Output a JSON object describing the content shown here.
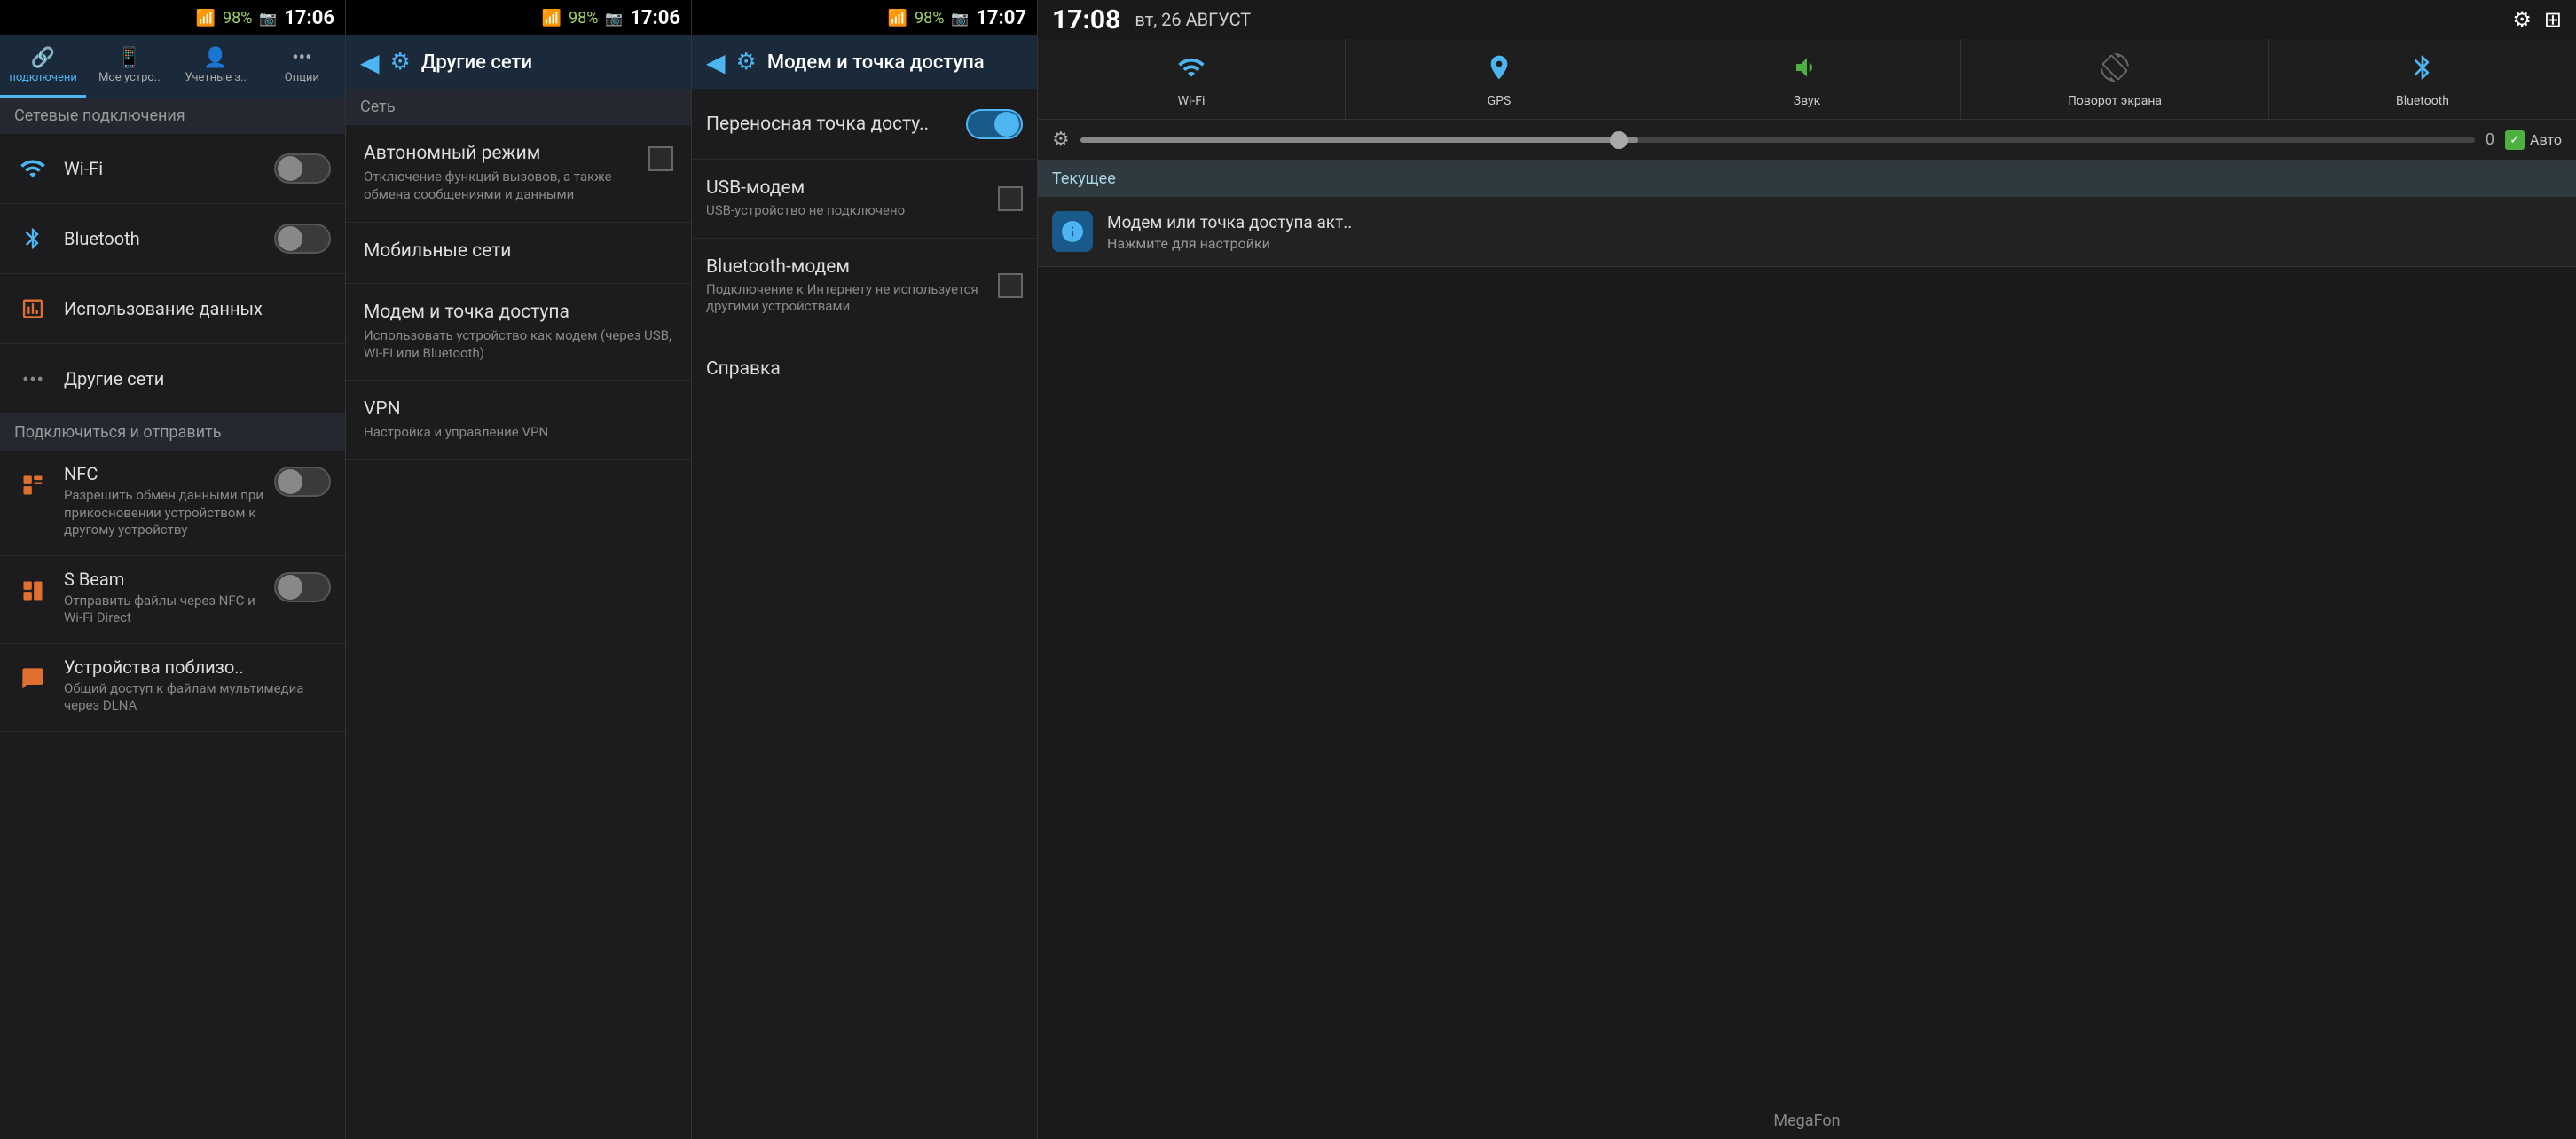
{
  "panel1": {
    "statusBar": {
      "signal": "▲▲",
      "battery": "98%",
      "time": "17:06",
      "cameraIcon": "▣"
    },
    "tabs": [
      {
        "label": "подключени",
        "icon": "🔗",
        "active": true
      },
      {
        "label": "Мое устро..",
        "icon": "📱",
        "active": false
      },
      {
        "label": "Учетные з..",
        "icon": "👤",
        "active": false
      },
      {
        "label": "Опции",
        "icon": "⋯",
        "active": false
      }
    ],
    "sectionHeader": "Сетевые подключения",
    "rows": [
      {
        "title": "Wi-Fi",
        "icon": "wifi",
        "toggle": true,
        "toggleOn": false
      },
      {
        "title": "Bluetooth",
        "icon": "bt",
        "toggle": true,
        "toggleOn": false
      }
    ],
    "section2Header": "",
    "rows2": [
      {
        "title": "Использование данных",
        "icon": "data"
      },
      {
        "title": "Другие сети",
        "icon": "net"
      }
    ],
    "section3Header": "Подключиться и отправить",
    "rows3": [
      {
        "title": "NFC",
        "subtitle": "Разрешить обмен данными при прикосновении устройством к другому устройству",
        "icon": "nfc",
        "toggle": true,
        "toggleOn": false
      },
      {
        "title": "S Beam",
        "subtitle": "Отправить файлы через NFC и Wi-Fi Direct",
        "icon": "sbeam",
        "toggle": true,
        "toggleOn": false
      },
      {
        "title": "Устройства поблизо..",
        "subtitle": "Общий доступ к файлам мультимедиа через DLNA",
        "icon": "nearby",
        "toggle": false
      }
    ]
  },
  "panel2": {
    "statusBar": {
      "battery": "98%",
      "time": "17:06",
      "cameraIcon": "▣"
    },
    "header": {
      "title": "Другие сети",
      "backIcon": "◀",
      "settingsIcon": "⚙"
    },
    "sectionHeader": "Сеть",
    "items": [
      {
        "title": "Автономный режим",
        "subtitle": "Отключение функций вызовов, а также обмена сообщениями и данными",
        "hasCheckbox": true
      },
      {
        "title": "Мобильные сети",
        "subtitle": "",
        "hasCheckbox": false
      },
      {
        "title": "Модем и точка доступа",
        "subtitle": "Использовать устройство как модем (через USB, Wi-Fi или Bluetooth)",
        "hasCheckbox": false
      },
      {
        "title": "VPN",
        "subtitle": "Настройка и управление VPN",
        "hasCheckbox": false
      }
    ]
  },
  "panel3": {
    "statusBar": {
      "battery": "98%",
      "time": "17:07",
      "cameraIcon": "▣"
    },
    "header": {
      "title": "Модем и точка доступа",
      "backIcon": "◀",
      "settingsIcon": "⚙"
    },
    "rows": [
      {
        "title": "Переносная точка досту..",
        "subtitle": "",
        "toggleOn": true
      },
      {
        "title": "USB-модем",
        "subtitle": "USB-устройство не подключено",
        "checkbox": true,
        "checked": false
      },
      {
        "title": "Bluetooth-модем",
        "subtitle": "Подключение к Интернету не используется другими устройствами",
        "checkbox": true,
        "checked": false
      },
      {
        "title": "Справка",
        "subtitle": "",
        "checkbox": false
      }
    ]
  },
  "panel4": {
    "statusBar": {
      "time": "17:08",
      "date": "вт, 26 АВГУСТ",
      "settingsIcon": "⚙",
      "gridIcon": "⊞"
    },
    "quickToggles": [
      {
        "icon": "wifi",
        "label": "Wi-Fi",
        "active": true
      },
      {
        "icon": "gps",
        "label": "GPS",
        "active": true
      },
      {
        "icon": "sound",
        "label": "Звук",
        "active": true
      },
      {
        "icon": "rotate",
        "label": "Поворот экрана",
        "active": false
      },
      {
        "icon": "bt",
        "label": "Bluetooth",
        "active": true
      }
    ],
    "brightness": {
      "value": "0",
      "autoLabel": "Авто",
      "autoChecked": true
    },
    "currentHeader": "Текущее",
    "notification": {
      "title": "Модем или точка доступа акт..",
      "subtitle": "Нажмите для настройки"
    },
    "carrier": "MegaFon"
  }
}
